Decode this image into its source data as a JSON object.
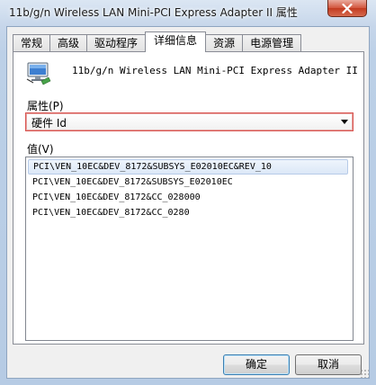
{
  "window": {
    "title": "11b/g/n  Wireless LAN Mini-PCI Express Adapter II 属性"
  },
  "tabs": [
    {
      "label": "常规"
    },
    {
      "label": "高级"
    },
    {
      "label": "驱动程序"
    },
    {
      "label": "详细信息",
      "active": true
    },
    {
      "label": "资源"
    },
    {
      "label": "电源管理"
    }
  ],
  "device": {
    "icon": "network-adapter-icon",
    "name": "11b/g/n  Wireless LAN Mini-PCI Express Adapter II"
  },
  "property": {
    "label": "属性(P)",
    "selected": "硬件 Id"
  },
  "values": {
    "label": "值(V)",
    "items": [
      "PCI\\VEN_10EC&DEV_8172&SUBSYS_E02010EC&REV_10",
      "PCI\\VEN_10EC&DEV_8172&SUBSYS_E02010EC",
      "PCI\\VEN_10EC&DEV_8172&CC_028000",
      "PCI\\VEN_10EC&DEV_8172&CC_0280"
    ],
    "selected_index": 0
  },
  "buttons": {
    "ok": "确定",
    "cancel": "取消"
  },
  "colors": {
    "close_button": "#c9402a",
    "selected_row": "#dce8f7",
    "highlight_border": "#d9534f"
  }
}
